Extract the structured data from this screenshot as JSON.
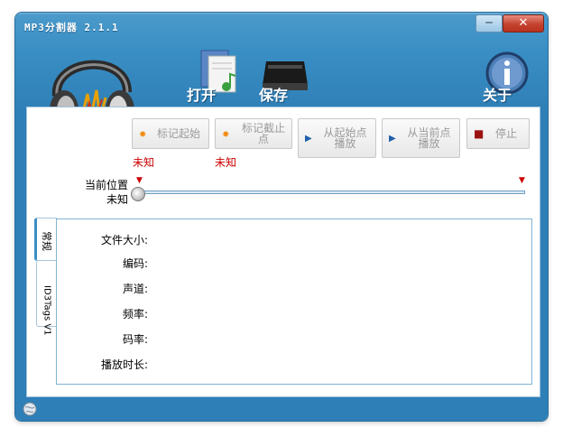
{
  "window": {
    "title": "MP3分割器 2.1.1",
    "minimize_glyph": "─",
    "close_glyph": "✕"
  },
  "toolbar": {
    "open_label": "打开",
    "save_label": "保存",
    "about_label": "关于"
  },
  "actions": [
    {
      "label": "标记起始",
      "icon": "star-icon"
    },
    {
      "label": "标记截止点",
      "icon": "star-icon"
    },
    {
      "label": "从起始点播放",
      "icon": "play-icon"
    },
    {
      "label": "从当前点播放",
      "icon": "play-icon"
    },
    {
      "label": "停止",
      "icon": "stop-icon"
    }
  ],
  "markers": {
    "start_value": "未知",
    "end_value": "未知"
  },
  "position": {
    "label": "当前位置",
    "value": "未知"
  },
  "tabs": [
    {
      "label": "常规"
    },
    {
      "label": "ID3Tags V1"
    }
  ],
  "fields": {
    "file_size": "文件大小:",
    "encoding": "编码:",
    "channels": "声道:",
    "frequency": "频率:",
    "bitrate": "码率:",
    "duration": "播放时长:"
  },
  "colors": {
    "accent": "#3a8fc4",
    "unknown_text": "#cc0000",
    "close_button": "#c44330"
  }
}
